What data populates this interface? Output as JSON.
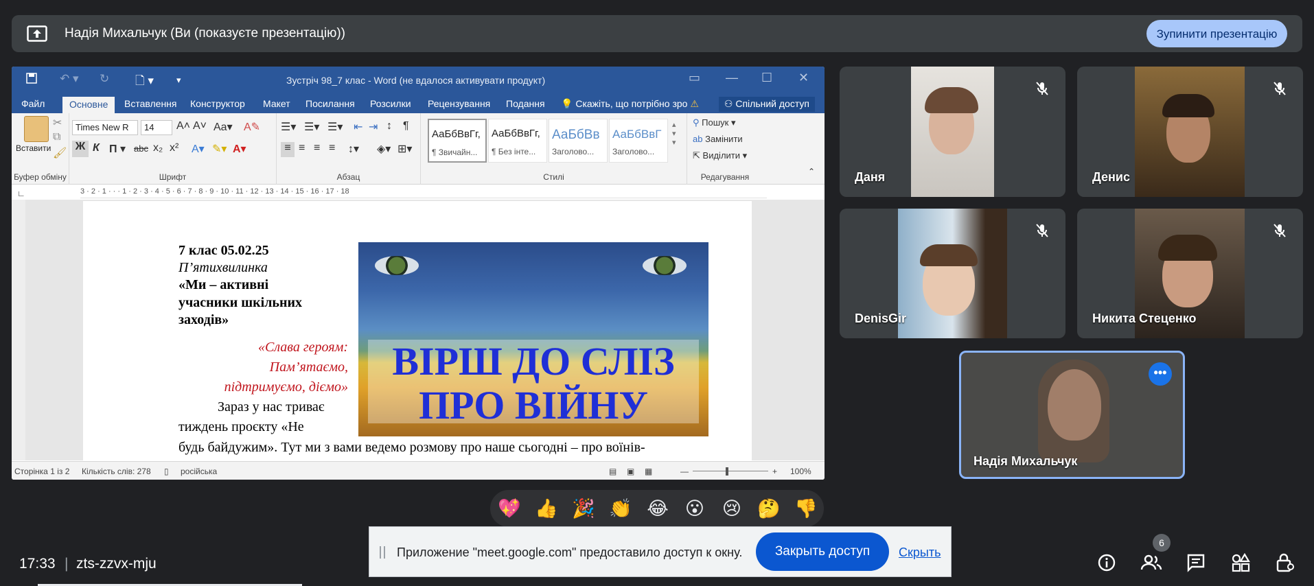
{
  "banner": {
    "title": "Надія Михальчук (Ви (показуєте презентацію))",
    "stop_button": "Зупинити презентацію"
  },
  "word": {
    "caption": "Зустріч 98_7 клас - Word (не вдалося активувати продукт)",
    "tabs": [
      "Файл",
      "Основне",
      "Вставлення",
      "Конструктор",
      "Макет",
      "Посилання",
      "Розсилки",
      "Рецензування",
      "Подання"
    ],
    "tell_me": "Скажіть, що потрібно зро",
    "share": "Спільний доступ",
    "paste": "Вставити",
    "font_name": "Times New R",
    "font_size": "14",
    "groups": [
      "Буфер обміну",
      "Шрифт",
      "Абзац",
      "Стилі",
      "Редагування"
    ],
    "styles": [
      {
        "sample": "АаБбВвГг,",
        "name": "¶ Звичайн..."
      },
      {
        "sample": "АаБбВвГг,",
        "name": "¶ Без інте..."
      },
      {
        "sample": "АаБбВв",
        "name": "Заголово..."
      },
      {
        "sample": "АаБбВвГ",
        "name": "Заголово..."
      }
    ],
    "editing": [
      "Пошук",
      "Замінити",
      "Виділити"
    ],
    "ruler": "3 · 2 · 1 · · · 1 · 2 · 3 · 4 · 5 · 6 · 7 · 8 · 9 · 10 · 11 · 12 · 13 · 14 · 15 · 16 · 17 · 18",
    "doc": {
      "line1": "7 клас 05.02.25",
      "line2": "П’ятихвилинка",
      "line3": "«Ми –  активні",
      "line4": "учасники шкільних",
      "line5": "заходів»",
      "red1": "«Слава героям:",
      "red2": "Пам’ятаємо,",
      "red3": "підтримуємо, діємо»",
      "body1": "Зараз у нас триває",
      "body2": "тиждень  проєкту   «Не",
      "body3": "будь байдужим». Тут ми з вами ведемо розмову  про наше сьогодні – про воїнів-",
      "poster_line1": "ВІРШ ДО СЛІЗ",
      "poster_line2": "ПРО ВІЙНУ"
    },
    "status": {
      "page": "Сторінка 1 із 2",
      "words": "Кількість слів: 278",
      "lang": "російська",
      "zoom": "100%"
    }
  },
  "participants": [
    {
      "name": "Даня",
      "muted": true
    },
    {
      "name": "Денис",
      "muted": true
    },
    {
      "name": "DenisGir",
      "muted": true
    },
    {
      "name": "Никита Стеценко",
      "muted": true
    }
  ],
  "self": {
    "name": "Надія Михальчук"
  },
  "reactions": [
    "💖",
    "👍",
    "🎉",
    "👏",
    "😂",
    "😮",
    "😢",
    "🤔",
    "👎"
  ],
  "notice": {
    "message": "Приложение \"meet.google.com\" предоставило доступ к окну.",
    "close_button": "Закрыть доступ",
    "hide_link": "Скрыть"
  },
  "bottom": {
    "time": "17:33",
    "separator": "|",
    "meeting_code": "zts-zzvx-mju",
    "participants_count": "6"
  }
}
